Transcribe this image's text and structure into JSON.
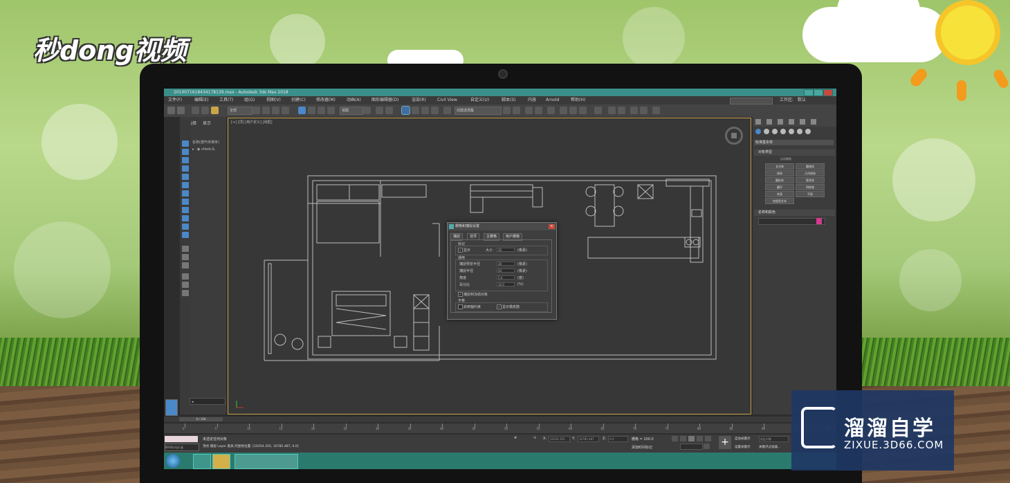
{
  "brand": {
    "logo_text": "秒dong视频"
  },
  "window": {
    "title": "20100716184341781​39.max - Autodesk 3ds Max 2018"
  },
  "menu": [
    "文件(F)",
    "编辑(E)",
    "工具(T)",
    "组(G)",
    "视图(V)",
    "创建(C)",
    "修改器(M)",
    "动画(A)",
    "图形编辑器(D)",
    "渲染(R)",
    "Civil View",
    "自定义(U)",
    "脚本(S)",
    "内容",
    "Arnold",
    "帮助(H)"
  ],
  "workspace": {
    "label": "工作区:",
    "value": "默认"
  },
  "toolbar": {
    "filter_value": "全部",
    "view_value": "视图",
    "selection_set": "创建选择集"
  },
  "scene": {
    "tab_select": "选择",
    "tab_display": "显示",
    "header": "名称(按升序排序)",
    "item": "zhbdc头"
  },
  "viewport": {
    "label": "[+] [顶] [用户定义] [线框]"
  },
  "dialog": {
    "title": "栅格和捕捉设置",
    "tabs": [
      "捕捉",
      "选项",
      "主栅格",
      "用户栅格"
    ],
    "marker": "标记",
    "show": "显示",
    "size_label": "大小",
    "size_value": "20",
    "unit_px": "(像素)",
    "general": "通用",
    "snap_preview_radius": "捕捉预览半径",
    "snap_preview_value": "30",
    "snap_radius": "捕捉半径",
    "snap_radius_value": "20",
    "angle": "角度",
    "angle_value": "5.0",
    "angle_unit": "(度)",
    "percent": "百分比",
    "percent_value": "10.0",
    "percent_unit": "(%)",
    "snap_frozen": "捕捉到冻结对象",
    "translate": "平移",
    "use_axis": "启用轴约束",
    "show_rubber": "显示橡皮筋"
  },
  "command_panel": {
    "dropdown": "标准基本体",
    "rollout_type": "对象类型",
    "autogrid": "自动栅格",
    "buttons": [
      "长方体",
      "圆锥体",
      "球体",
      "几何球体",
      "圆柱体",
      "管状体",
      "圆环",
      "四棱锥",
      "茶壶",
      "平面",
      "加强型文本"
    ],
    "rollout_name": "名称和颜色"
  },
  "timeline": {
    "frame": "0 / 100",
    "ticks": [
      "0",
      "5",
      "10",
      "15",
      "20",
      "25",
      "30",
      "35",
      "40",
      "45",
      "50",
      "55",
      "60",
      "65",
      "70",
      "75",
      "80",
      "85",
      "90",
      "95",
      "100"
    ]
  },
  "status": {
    "line1": "未选定任何对象",
    "line2": "顶点 捕捉 Layer 家具 的坐标位置: [10254.355, 10785.487, 0.0]",
    "x": "10254.355",
    "y": "10785.487",
    "z": "0.0",
    "grid": "栅格 = 100.0",
    "add_time_tag": "添加时间标记",
    "auto_key": "自动关键点",
    "set_key": "设置关键点",
    "selected": "选定对象",
    "key_filters": "关键点过滤器...",
    "maxscript": "MAXScript 迷"
  },
  "watermark": {
    "title": "溜溜自学",
    "sub": "ZIXUE.3D66.COM"
  }
}
